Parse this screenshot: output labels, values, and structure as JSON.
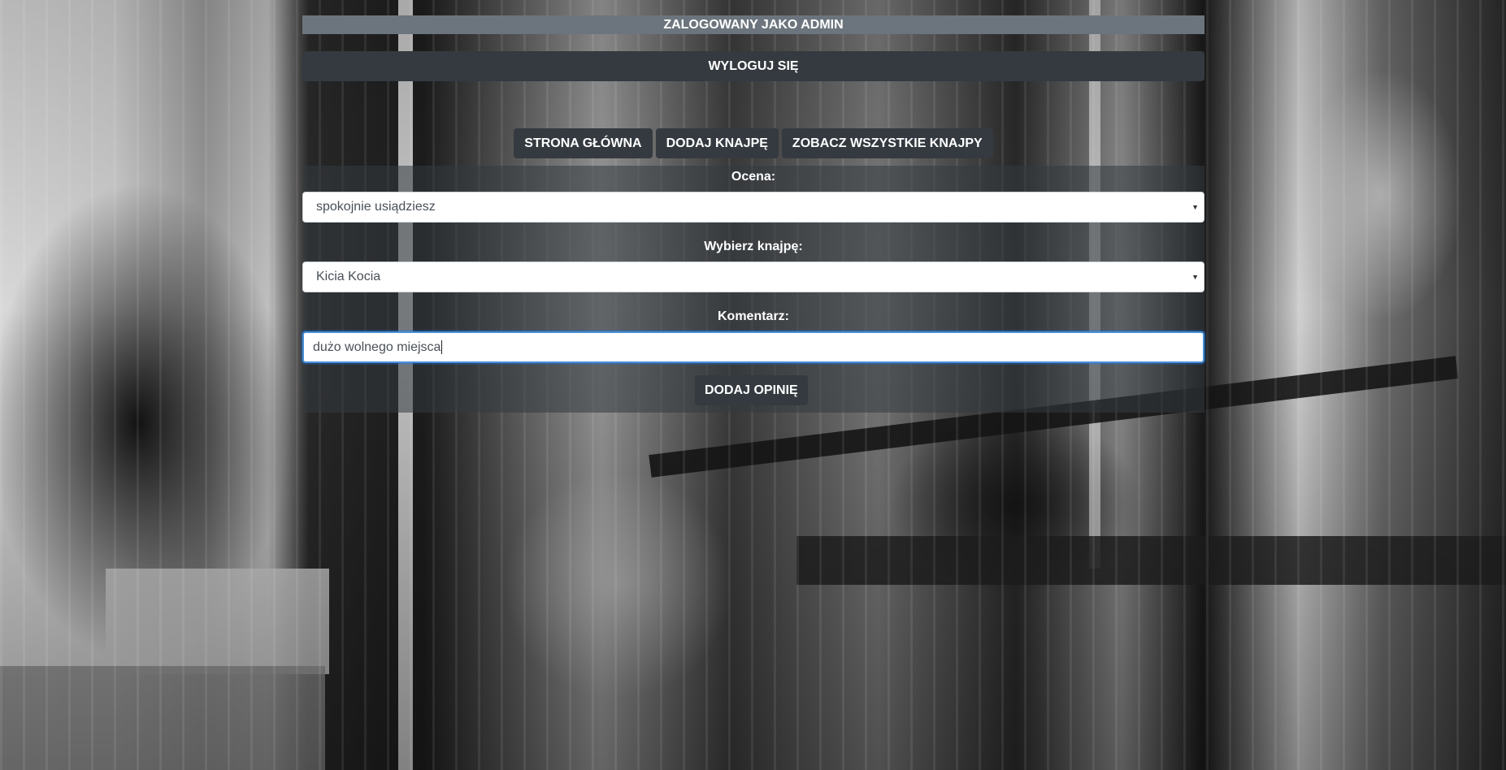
{
  "header": {
    "user_status": "ZALOGOWANY JAKO ADMIN",
    "logout_label": "WYLOGUJ SIĘ"
  },
  "nav": {
    "items": [
      {
        "label": "STRONA GŁÓWNA"
      },
      {
        "label": "DODAJ KNAJPĘ"
      },
      {
        "label": "ZOBACZ WSZYSTKIE KNAJPY"
      }
    ]
  },
  "form": {
    "rating_label": "Ocena:",
    "rating_value": "spokojnie usiądziesz",
    "venue_label": "Wybierz knajpę:",
    "venue_value": "Kicia Kocia",
    "comment_label": "Komentarz:",
    "comment_value": "dużo wolnego miejsca",
    "submit_label": "DODAJ OPINIĘ"
  },
  "colors": {
    "user_bar": "#6c757d",
    "dark_button": "#343a40",
    "focus_border": "#4a90d9"
  }
}
